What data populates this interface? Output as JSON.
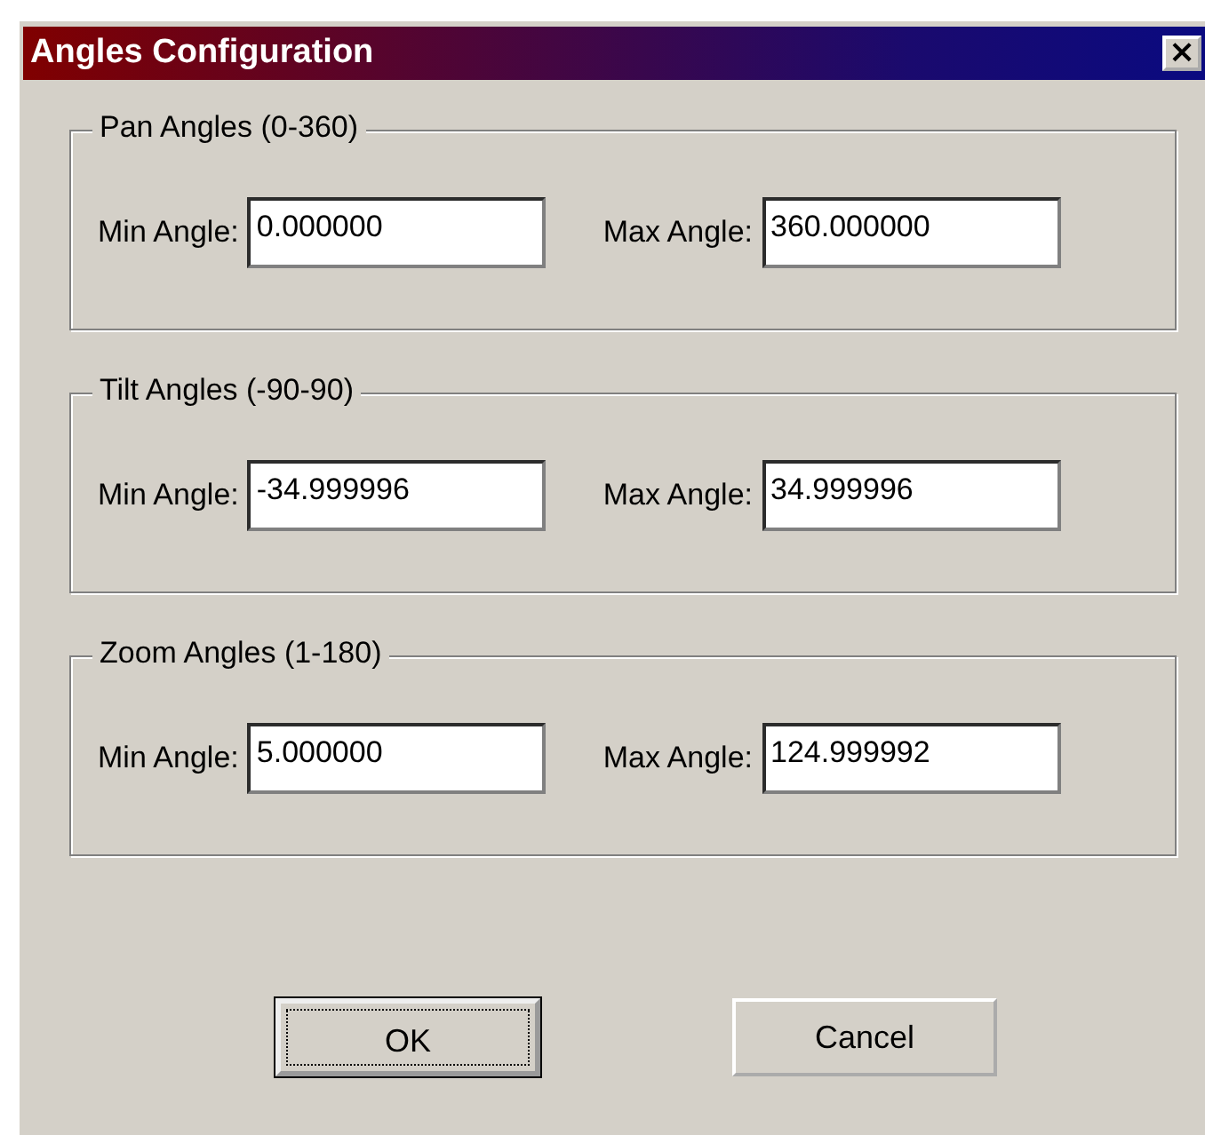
{
  "window": {
    "title": "Angles Configuration",
    "close": "×"
  },
  "groups": [
    {
      "title": "Pan Angles (0-360)",
      "min_label": "Min Angle:",
      "min_value": "0.000000",
      "max_label": "Max Angle:",
      "max_value": "360.000000"
    },
    {
      "title": "Tilt Angles (-90-90)",
      "min_label": "Min Angle:",
      "min_value": "-34.999996",
      "max_label": "Max Angle:",
      "max_value": "34.999996"
    },
    {
      "title": "Zoom Angles (1-180)",
      "min_label": "Min Angle:",
      "min_value": "5.000000",
      "max_label": "Max Angle:",
      "max_value": "124.999992"
    }
  ],
  "buttons": [
    {
      "label": "OK",
      "default": true
    },
    {
      "label": "Cancel",
      "default": false
    }
  ]
}
